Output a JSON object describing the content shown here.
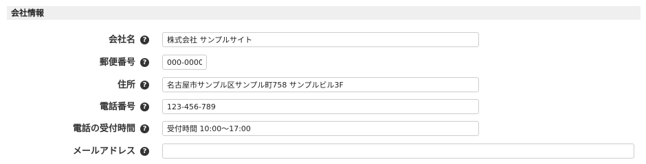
{
  "section": {
    "title": "会社情報"
  },
  "fields": [
    {
      "label": "会社名",
      "value": "株式会社 サンプルサイト",
      "placeholder": ""
    },
    {
      "label": "郵便番号",
      "value": "000-0000",
      "placeholder": ""
    },
    {
      "label": "住所",
      "value": "名古屋市サンプル区サンプル町758 サンプルビル3F",
      "placeholder": ""
    },
    {
      "label": "電話番号",
      "value": "123-456-789",
      "placeholder": ""
    },
    {
      "label": "電話の受付時間",
      "value": "受付時間 10:00〜17:00",
      "placeholder": ""
    },
    {
      "label": "メールアドレス",
      "value": "",
      "placeholder": ""
    }
  ],
  "help_icon_glyph": "?",
  "icons": {
    "help": "question-circle-icon"
  },
  "colors": {
    "header_bg": "#efefef",
    "border": "#cccccc",
    "label_text": "#333333",
    "icon_bg": "#333333"
  }
}
